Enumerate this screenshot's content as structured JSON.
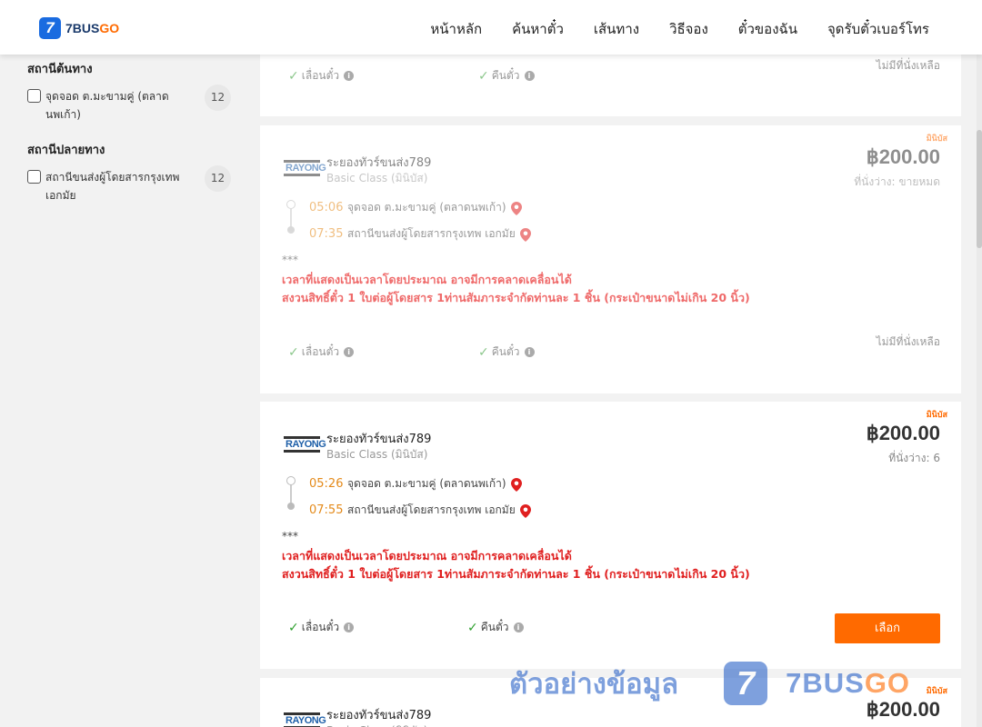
{
  "header": {
    "logo_mark": "7",
    "logo_text": "7BUS",
    "logo_text_go": "GO",
    "nav": [
      "หน้าหลัก",
      "ค้นหาตั๋ว",
      "เส้นทาง",
      "วิธีจอง",
      "ตั๋วของฉัน",
      "จุดรับตั๋วเบอร์โทร"
    ]
  },
  "sidebar": {
    "origin_title": "สถานีต้นทาง",
    "origin_item": {
      "label": "จุดจอด ต.มะขามคู่ (ตลาดนพเก้า)",
      "count": "12",
      "checked": false
    },
    "dest_title": "สถานีปลายทาง",
    "dest_item": {
      "label": "สถานีขนส่งผู้โดยสารกรุงเทพ เอกมัย",
      "count": "12",
      "checked": false
    }
  },
  "common": {
    "operator_logo_text": "RAYONG",
    "bus_badge": "มินิบัส",
    "operator": "ระยองทัวร์ขนส่ง789",
    "bus_class": "Basic Class (มินิบัส)",
    "origin_place": "จุดจอด ต.มะขามคู่ (ตลาดนพเก้า)",
    "dest_place": "สถานีขนส่งผู้โดยสารกรุงเทพ เอกมัย",
    "stars": "***",
    "notice_line1": "เวลาที่แสดงเป็นเวลาโดยประมาณ อาจมีการคลาดเคลื่อนได้",
    "notice_line2": "สงวนสิทธิ์ตั๋ว 1 ใบต่อผู้โดยสาร 1ท่านสัมภาระจำกัดท่านละ 1 ชิ้น (กระเป๋าขนาดไม่เกิน 20 นิ้ว)",
    "reschedule": "เลื่อนตั๋ว",
    "refund": "คืนตั๋ว",
    "info_glyph": "i",
    "check_glyph": "✓",
    "no_seat": "ไม่มีที่นั่งเหลือ",
    "select": "เลือก"
  },
  "cards": [
    {
      "price": "฿200.00",
      "seats": "ที่นั่งว่าง: ขายหมด",
      "depart_time": "05:06",
      "arrive_time": "07:35",
      "available": false
    },
    {
      "price": "฿200.00",
      "seats": "ที่นั่งว่าง: 6",
      "depart_time": "05:26",
      "arrive_time": "07:55",
      "available": true
    },
    {
      "price": "฿200.00"
    }
  ],
  "watermark": {
    "text": "ตัวอย่างข้อมูล",
    "logo_mark": "7",
    "brand": "7BUS",
    "brand_go": "GO"
  },
  "colors": {
    "accent": "#ff6a00",
    "brand_blue": "#1a6be0",
    "notice_red": "#e02020",
    "time_orange": "#e48a1a"
  }
}
